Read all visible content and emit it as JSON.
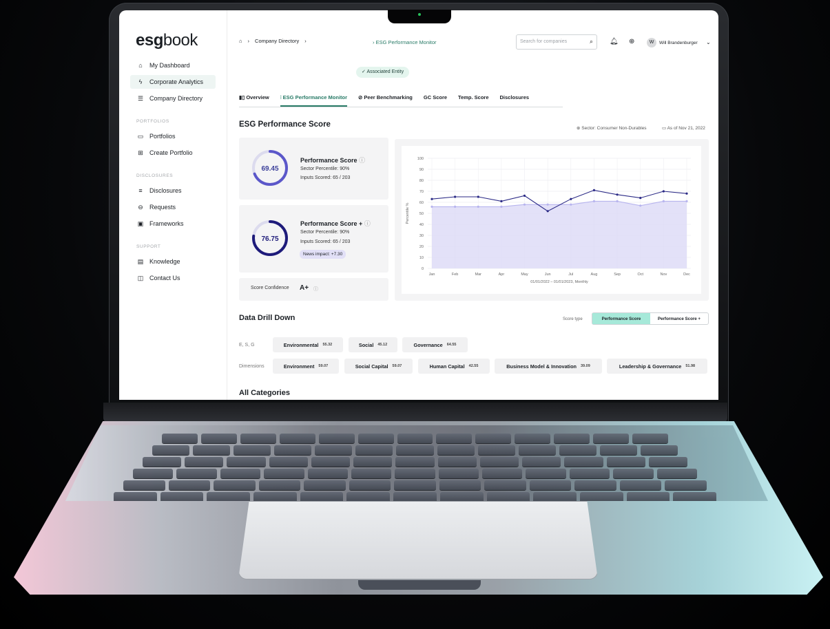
{
  "sidebar": {
    "logo_bold": "esg",
    "logo_rest": "book",
    "items": [
      {
        "label": "My Dashboard",
        "icon": "home-icon"
      },
      {
        "label": "Corporate Analytics",
        "icon": "lightning-icon"
      },
      {
        "label": "Company Directory",
        "icon": "list-icon"
      }
    ],
    "portfolios_header": "PORTFOLIOS",
    "portfolio_items": [
      {
        "label": "Portfolios",
        "icon": "folder-icon"
      },
      {
        "label": "Create Portfolio",
        "icon": "create-portfolio-icon"
      }
    ],
    "disclosures_header": "DISCLOSURES",
    "disclosure_items": [
      {
        "label": "Disclosures",
        "icon": "disclosures-icon"
      },
      {
        "label": "Requests",
        "icon": "inbox-icon"
      },
      {
        "label": "Frameworks",
        "icon": "frameworks-icon"
      }
    ],
    "support_header": "SUPPORT",
    "support_items": [
      {
        "label": "Knowledge",
        "icon": "book-icon"
      },
      {
        "label": "Contact Us",
        "icon": "chat-icon"
      }
    ]
  },
  "header": {
    "crumb1": "Company Directory",
    "crumb_active": "ESG Performance Monitor",
    "search_placeholder": "Search for companies",
    "avatar_initial": "W",
    "user_name": "Will Brandenburger"
  },
  "entity_badge": "Associated Entity",
  "tabs": [
    "Overview",
    "ESG Performance Monitor",
    "Peer Benchmarking",
    "GC Score",
    "Temp. Score",
    "Disclosures"
  ],
  "section_title": "ESG Performance Score",
  "sector": "Sector: Consumer Non-Durables",
  "as_of": "As of Nov 21, 2022",
  "score1": {
    "value": "69.45",
    "title": "Performance Score",
    "percentile": "Sector Percentile: 90%",
    "inputs": "Inputs Scored: 65 / 203",
    "fraction": 0.69,
    "color": "#5b57c9"
  },
  "score2": {
    "value": "76.75",
    "title": "Performance Score +",
    "percentile": "Sector Percentile: 90%",
    "inputs": "Inputs Scored: 65 / 203",
    "news": "News impact: +7.30",
    "fraction": 0.77,
    "color": "#1e1b7a"
  },
  "confidence": {
    "label": "Score Confidence",
    "value": "A+"
  },
  "chart_data": {
    "type": "line",
    "categories": [
      "Jan",
      "Feb",
      "Mar",
      "Apr",
      "May",
      "Jun",
      "Jul",
      "Aug",
      "Sep",
      "Oct",
      "Nov",
      "Dec"
    ],
    "series": [
      {
        "values": [
          63,
          65,
          65,
          61,
          66,
          52,
          63,
          71,
          67,
          64,
          70,
          68
        ],
        "color": "#2b2a86"
      },
      {
        "values": [
          56,
          56,
          56,
          56,
          58,
          58,
          58,
          61,
          61,
          57,
          61,
          61
        ],
        "color": "#b7b4ee"
      }
    ],
    "ylim": [
      0,
      100
    ],
    "yticks": [
      0,
      10,
      20,
      30,
      40,
      50,
      60,
      70,
      80,
      90,
      100
    ],
    "ylabel": "Percentile %",
    "xlabel": "01/01/2022 – 01/01/2023, Monthly",
    "grid": true
  },
  "drilldown": {
    "title": "Data Drill Down",
    "score_type_label": "Score type",
    "toggle": [
      "Performance Score",
      "Performance Score +"
    ],
    "esg_label": "E, S, G",
    "esg": [
      {
        "name": "Environmental",
        "value": "55.32"
      },
      {
        "name": "Social",
        "value": "45.12"
      },
      {
        "name": "Governance",
        "value": "64.55"
      }
    ],
    "dimensions_label": "Dimensions",
    "dimensions": [
      {
        "name": "Environment",
        "value": "59.07"
      },
      {
        "name": "Social Capital",
        "value": "59.07"
      },
      {
        "name": "Human Capital",
        "value": "42.55"
      },
      {
        "name": "Business Model & Innovation",
        "value": "39.09"
      },
      {
        "name": "Leadership & Governance",
        "value": "51.98"
      }
    ]
  },
  "all_categories": "All Categories"
}
